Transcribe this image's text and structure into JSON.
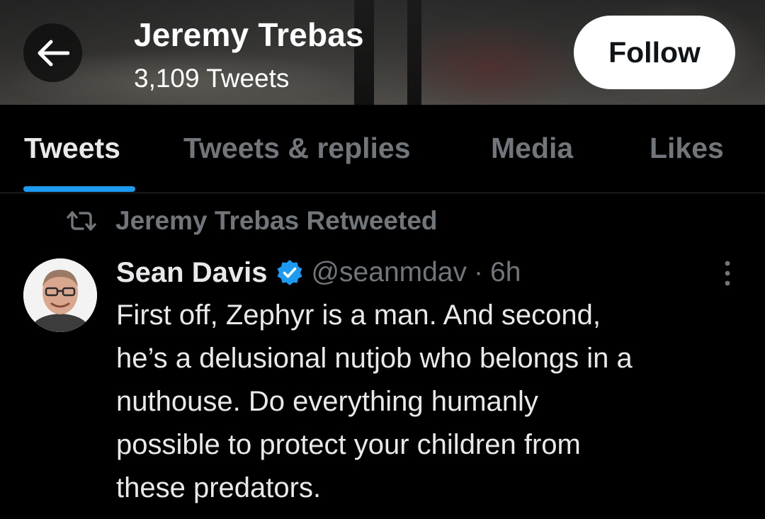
{
  "header": {
    "title": "Jeremy Trebas",
    "tweet_count": "3,109 Tweets",
    "back_icon": "arrow-left-icon",
    "follow_label": "Follow"
  },
  "tabs": [
    {
      "label": "Tweets",
      "active": true
    },
    {
      "label": "Tweets & replies",
      "active": false
    },
    {
      "label": "Media",
      "active": false
    },
    {
      "label": "Likes",
      "active": false
    }
  ],
  "tweet": {
    "retweet_label": "Jeremy Trebas Retweeted",
    "retweet_icon": "retweet-icon",
    "author_name": "Sean Davis",
    "verified": true,
    "handle": "@seanmdav",
    "separator": "·",
    "time": "6h",
    "more_icon": "vertical-ellipsis-icon",
    "text": "First off, Zephyr is a man. And second,\nhe’s a delusional nutjob who belongs in a\nnuthouse. Do everything humanly\npossible to protect your children from\nthese predators."
  },
  "colors": {
    "background": "#000000",
    "text_primary": "#e7e9ea",
    "text_secondary": "#71767b",
    "accent": "#1d9bf0",
    "follow_bg": "#ffffff"
  }
}
